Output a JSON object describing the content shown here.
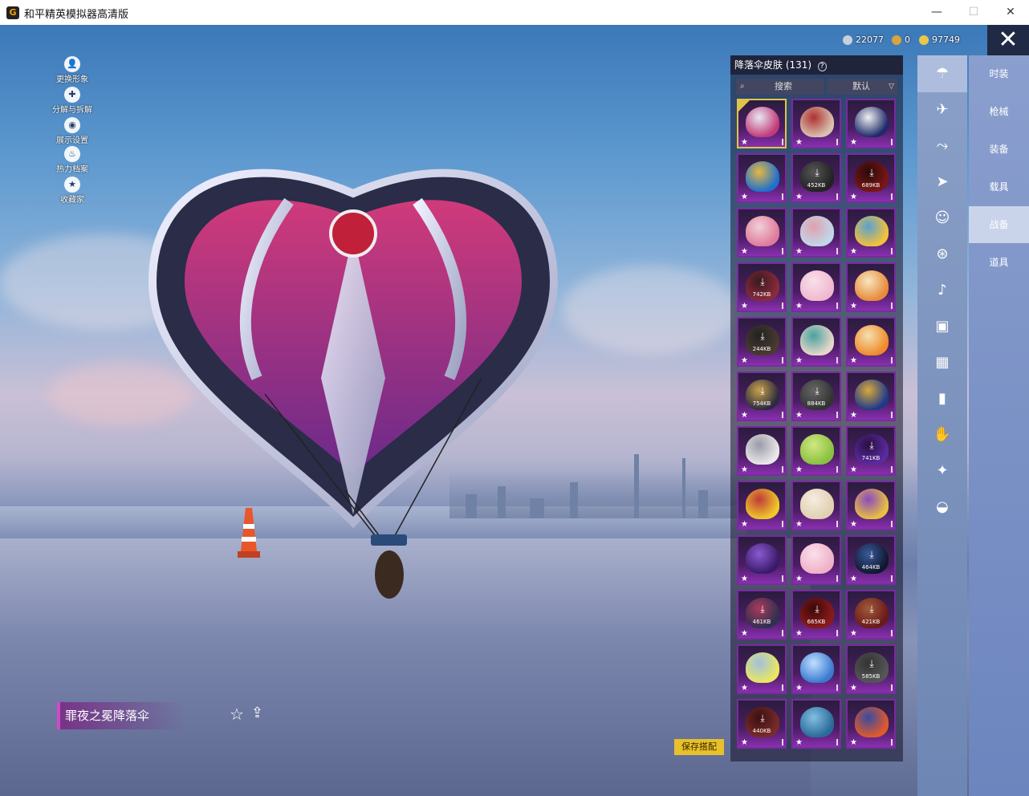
{
  "window": {
    "title": "和平精英模拟器高清版",
    "min": "—",
    "max": "☐",
    "close": "✕"
  },
  "left_menu": [
    {
      "label": "更换形象",
      "icon": "person-icon",
      "glyph": "👤"
    },
    {
      "label": "分解与拆解",
      "icon": "puzzle-icon",
      "glyph": "✚"
    },
    {
      "label": "展示设置",
      "icon": "eye-icon",
      "glyph": "◉"
    },
    {
      "label": "热力档案",
      "icon": "flame-icon",
      "glyph": "♨"
    },
    {
      "label": "收藏家",
      "icon": "badge-icon",
      "glyph": "★"
    }
  ],
  "currency": [
    {
      "value": "22077",
      "color": "#c8d0dc",
      "icon": "silver-coin-icon"
    },
    {
      "value": "0",
      "color": "#d9a43a",
      "icon": "gold-token-icon"
    },
    {
      "value": "97749",
      "color": "#e8c84a",
      "icon": "gold-coin-icon"
    }
  ],
  "panel": {
    "title": "降落伞皮肤 (131)",
    "help": "?",
    "search_label": "搜索",
    "sort_label": "默认"
  },
  "skins": [
    {
      "size": "",
      "colors": [
        "#c23a7a",
        "#e8e8f0"
      ],
      "selected": true
    },
    {
      "size": "",
      "colors": [
        "#d8c3b0",
        "#b03030"
      ]
    },
    {
      "size": "",
      "colors": [
        "#1e2a6a",
        "#f0f0f0"
      ]
    },
    {
      "size": "",
      "colors": [
        "#1d6fd0",
        "#e6b840"
      ]
    },
    {
      "size": "452KB",
      "colors": [
        "#222",
        "#555"
      ]
    },
    {
      "size": "689KB",
      "colors": [
        "#7a1616",
        "#2a0a0a"
      ]
    },
    {
      "size": "",
      "colors": [
        "#e07a9a",
        "#f0d0d8"
      ]
    },
    {
      "size": "",
      "colors": [
        "#c0d8e8",
        "#e0a0b0"
      ]
    },
    {
      "size": "",
      "colors": [
        "#f2c23a",
        "#5aa0d0"
      ]
    },
    {
      "size": "742KB",
      "colors": [
        "#8a2a3a",
        "#3a1a20"
      ]
    },
    {
      "size": "",
      "colors": [
        "#f0b8d0",
        "#f8e0ea"
      ]
    },
    {
      "size": "",
      "colors": [
        "#e88a3a",
        "#f6e6c0"
      ]
    },
    {
      "size": "244KB",
      "colors": [
        "#4a3a30",
        "#222"
      ]
    },
    {
      "size": "",
      "colors": [
        "#e6d8c8",
        "#4aa0a0"
      ]
    },
    {
      "size": "",
      "colors": [
        "#f08a2a",
        "#f4e0b0"
      ]
    },
    {
      "size": "754KB",
      "colors": [
        "#2a2a40",
        "#c8a24a"
      ]
    },
    {
      "size": "884KB",
      "colors": [
        "#333",
        "#666"
      ]
    },
    {
      "size": "",
      "colors": [
        "#1e3a8a",
        "#d8a83a"
      ]
    },
    {
      "size": "",
      "colors": [
        "#e8e8e8",
        "#9a9aa8"
      ]
    },
    {
      "size": "",
      "colors": [
        "#8ac040",
        "#d0e880"
      ]
    },
    {
      "size": "741KB",
      "colors": [
        "#5a2aa0",
        "#2a1040"
      ]
    },
    {
      "size": "",
      "colors": [
        "#f0c82a",
        "#c03a3a"
      ]
    },
    {
      "size": "",
      "colors": [
        "#e0d0b0",
        "#f6ece0"
      ]
    },
    {
      "size": "",
      "colors": [
        "#e8c040",
        "#8a4ac0"
      ]
    },
    {
      "size": "",
      "colors": [
        "#3a1a6a",
        "#8a5ad0"
      ]
    },
    {
      "size": "",
      "colors": [
        "#f0b0c8",
        "#fae0ea"
      ]
    },
    {
      "size": "464KB",
      "colors": [
        "#101830",
        "#3a5a9a"
      ]
    },
    {
      "size": "461KB",
      "colors": [
        "#303050",
        "#aa3a5a"
      ]
    },
    {
      "size": "665KB",
      "colors": [
        "#8a1a1a",
        "#3a0a0a"
      ]
    },
    {
      "size": "421KB",
      "colors": [
        "#6a1a1a",
        "#a05a3a"
      ]
    },
    {
      "size": "",
      "colors": [
        "#e8e860",
        "#a0c0e0"
      ]
    },
    {
      "size": "",
      "colors": [
        "#3a7ad0",
        "#c0e0ff"
      ]
    },
    {
      "size": "585KB",
      "colors": [
        "#555",
        "#333"
      ]
    },
    {
      "size": "440KB",
      "colors": [
        "#7a2a2a",
        "#3a1010"
      ]
    },
    {
      "size": "",
      "colors": [
        "#2a6a9a",
        "#80c0e0"
      ]
    },
    {
      "size": "",
      "colors": [
        "#e05a2a",
        "#3a4aa0"
      ]
    }
  ],
  "categories": [
    {
      "icon": "parachute-icon",
      "glyph": "☂",
      "active": true
    },
    {
      "icon": "plane-icon",
      "glyph": "✈"
    },
    {
      "icon": "drone-icon",
      "glyph": "⤳"
    },
    {
      "icon": "jet-icon",
      "glyph": "➤"
    },
    {
      "icon": "emote-icon",
      "glyph": "☺"
    },
    {
      "icon": "robot-icon",
      "glyph": "⊛"
    },
    {
      "icon": "speaker-icon",
      "glyph": "♪"
    },
    {
      "icon": "chat-bubble-icon",
      "glyph": "▣"
    },
    {
      "icon": "picture-icon",
      "glyph": "▦"
    },
    {
      "icon": "extinguisher-icon",
      "glyph": "▮"
    },
    {
      "icon": "hand-icon",
      "glyph": "✋"
    },
    {
      "icon": "sparkle-wand-icon",
      "glyph": "✦"
    },
    {
      "icon": "saucer-icon",
      "glyph": "◒"
    }
  ],
  "tabs": [
    {
      "label": "时装"
    },
    {
      "label": "枪械"
    },
    {
      "label": "装备"
    },
    {
      "label": "载具"
    },
    {
      "label": "战备",
      "active": true
    },
    {
      "label": "道具"
    }
  ],
  "close_panel": "✕",
  "item": {
    "name": "罪夜之冕降落伞",
    "fav_icon": "☆",
    "share_icon": "⇪"
  },
  "save_label": "保存搭配"
}
